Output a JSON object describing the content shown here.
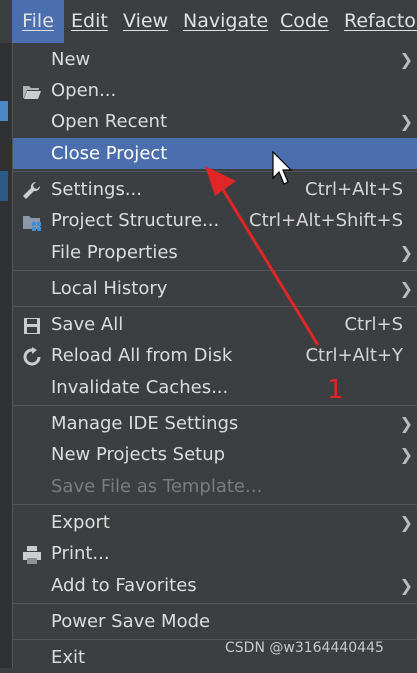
{
  "menubar": {
    "items": [
      {
        "label": "File"
      },
      {
        "label": "Edit"
      },
      {
        "label": "View"
      },
      {
        "label": "Navigate"
      },
      {
        "label": "Code"
      },
      {
        "label": "Refactor"
      }
    ]
  },
  "menu": {
    "items": [
      {
        "label": "New",
        "shortcut": "",
        "submenu": true,
        "icon": ""
      },
      {
        "label": "Open...",
        "shortcut": "",
        "submenu": false,
        "icon": "folder-open-icon"
      },
      {
        "label": "Open Recent",
        "shortcut": "",
        "submenu": true,
        "icon": ""
      },
      {
        "label": "Close Project",
        "shortcut": "",
        "submenu": false,
        "icon": "",
        "selected": true
      },
      {
        "label": "Settings...",
        "shortcut": "Ctrl+Alt+S",
        "submenu": false,
        "icon": "wrench-icon"
      },
      {
        "label": "Project Structure...",
        "shortcut": "Ctrl+Alt+Shift+S",
        "submenu": false,
        "icon": "project-structure-icon"
      },
      {
        "label": "File Properties",
        "shortcut": "",
        "submenu": true,
        "icon": ""
      },
      {
        "label": "Local History",
        "shortcut": "",
        "submenu": true,
        "icon": ""
      },
      {
        "label": "Save All",
        "shortcut": "Ctrl+S",
        "submenu": false,
        "icon": "floppy-disk-icon"
      },
      {
        "label": "Reload All from Disk",
        "shortcut": "Ctrl+Alt+Y",
        "submenu": false,
        "icon": "reload-icon"
      },
      {
        "label": "Invalidate Caches...",
        "shortcut": "",
        "submenu": false,
        "icon": ""
      },
      {
        "label": "Manage IDE Settings",
        "shortcut": "",
        "submenu": true,
        "icon": ""
      },
      {
        "label": "New Projects Setup",
        "shortcut": "",
        "submenu": true,
        "icon": ""
      },
      {
        "label": "Save File as Template...",
        "shortcut": "",
        "submenu": false,
        "icon": "",
        "disabled": true
      },
      {
        "label": "Export",
        "shortcut": "",
        "submenu": true,
        "icon": ""
      },
      {
        "label": "Print...",
        "shortcut": "",
        "submenu": false,
        "icon": "printer-icon"
      },
      {
        "label": "Add to Favorites",
        "shortcut": "",
        "submenu": true,
        "icon": ""
      },
      {
        "label": "Power Save Mode",
        "shortcut": "",
        "submenu": false,
        "icon": ""
      },
      {
        "label": "Exit",
        "shortcut": "",
        "submenu": false,
        "icon": ""
      }
    ]
  },
  "annotation": {
    "label": "1",
    "color": "#e02626"
  },
  "watermark": "CSDN @w3164440445",
  "colors": {
    "background": "#3c3f41",
    "selection": "#4b6eaf",
    "arrow": "#e02626"
  }
}
